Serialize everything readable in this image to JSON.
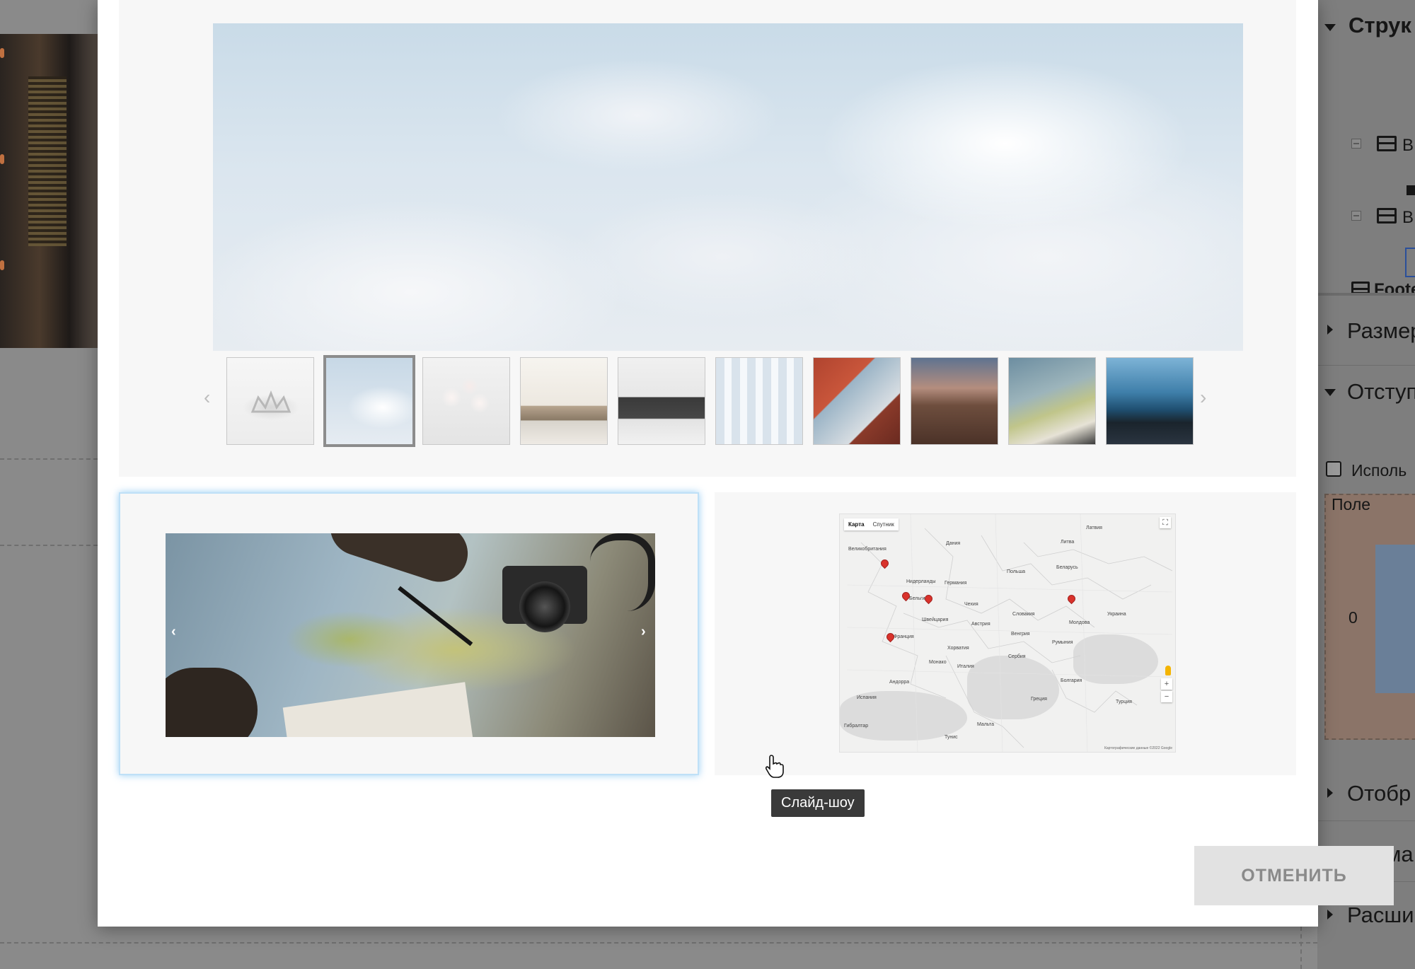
{
  "panel": {
    "title": "Струк",
    "tree": [
      {
        "label": "В"
      },
      {
        "label": "В"
      }
    ],
    "footer_label": "Foote",
    "sections": {
      "size": "Размер",
      "padding": "Отступ",
      "use_checkbox": "Исполь",
      "field": "Поле",
      "field_value": "0",
      "display": "Отобр",
      "animation": "Анима",
      "advanced": "Расши"
    }
  },
  "gallery": {
    "thumb_prev_icon": "chevron-left-icon",
    "thumb_next_icon": "chevron-right-icon",
    "active_thumb_index": 1,
    "thumbnails": [
      "crown",
      "clouds",
      "orchids",
      "living-room",
      "armchair",
      "white-columns",
      "tent",
      "mountain-sunset",
      "map-pen",
      "sea-rocks"
    ]
  },
  "slideshow": {
    "prev_arrow": "‹",
    "next_arrow": "›"
  },
  "map": {
    "tab_map": "Карта",
    "tab_satellite": "Спутник",
    "zoom_in": "+",
    "zoom_out": "−",
    "fullscreen_icon": "fullscreen-icon",
    "labels": [
      "Великобритания",
      "Германия",
      "Польша",
      "Беларусь",
      "Украина",
      "Франция",
      "Италия",
      "Испания",
      "Румыния",
      "Греция",
      "Турция",
      "Мальта",
      "Нидерланды",
      "Бельгия",
      "Австрия",
      "Венгрия",
      "Сербия",
      "Болгария",
      "Дания",
      "Литва",
      "Латвия",
      "Чехия",
      "Словакия",
      "Хорватия",
      "Монако",
      "Андорра",
      "Молдова",
      "Гибралтар",
      "Тунис",
      "Швейцария"
    ],
    "footer": "Картографические данные ©2022 Google"
  },
  "tooltip": "Слайд-шоу",
  "cancel_button": "ОТМЕНИТЬ"
}
